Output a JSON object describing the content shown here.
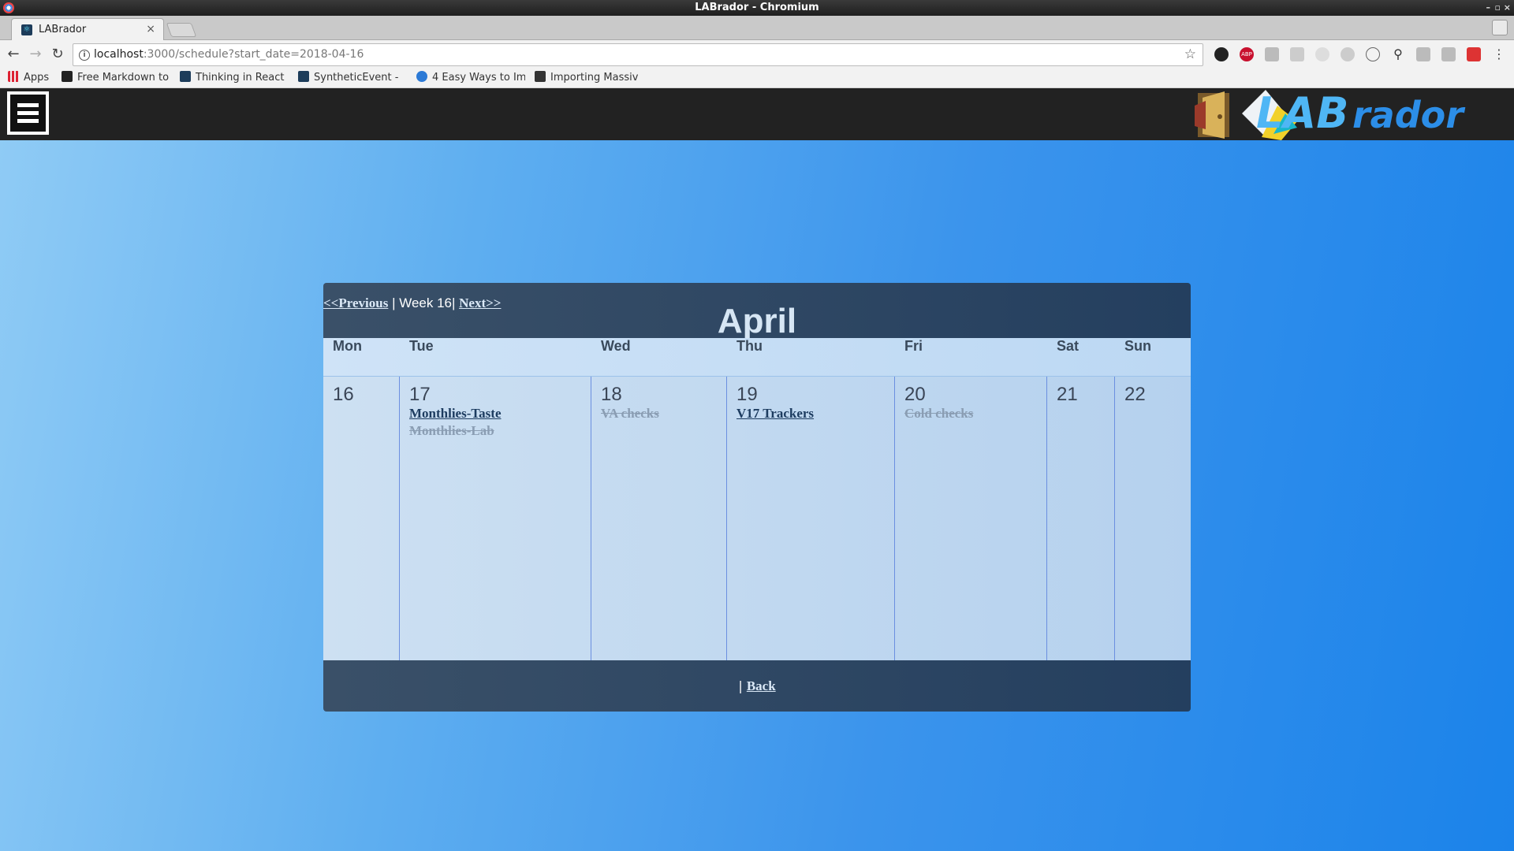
{
  "window": {
    "title": "LABrador - Chromium",
    "controls": [
      "–",
      "▫",
      "×"
    ]
  },
  "tab": {
    "title": "LABrador",
    "close": "×"
  },
  "toolbar": {
    "url_host": "localhost",
    "url_rest": ":3000/schedule?start_date=2018-04-16"
  },
  "bookmarks": [
    {
      "label": "Apps",
      "icon": "apps-grid-icon",
      "color": "#d23"
    },
    {
      "label": "Free Markdown to",
      "icon": "markdown-icon",
      "color": "#222"
    },
    {
      "label": "Thinking in React",
      "icon": "react-icon",
      "color": "#1d3c5a"
    },
    {
      "label": "SyntheticEvent -",
      "icon": "react-icon",
      "color": "#1d3c5a"
    },
    {
      "label": "4 Easy Ways to Im",
      "icon": "globe-icon",
      "color": "#2c7ad6"
    },
    {
      "label": "Importing Massiv",
      "icon": "article-icon",
      "color": "#333"
    }
  ],
  "app": {
    "logo_text": "LABrador"
  },
  "calendar": {
    "prev_label": "<<Previous",
    "week_label": " | Week 16| ",
    "next_label": "Next>>",
    "month": "April",
    "day_headers": [
      "Mon",
      "Tue",
      "Wed",
      "Thu",
      "Fri",
      "Sat",
      "Sun"
    ],
    "days": [
      {
        "num": "16",
        "events": []
      },
      {
        "num": "17",
        "events": [
          {
            "label": "Monthlies-Taste",
            "done": false
          },
          {
            "label": "Monthlies-Lab",
            "done": true
          }
        ]
      },
      {
        "num": "18",
        "events": [
          {
            "label": "VA checks",
            "done": true
          }
        ]
      },
      {
        "num": "19",
        "events": [
          {
            "label": "V17 Trackers",
            "done": false
          }
        ]
      },
      {
        "num": "20",
        "events": [
          {
            "label": "Cold checks",
            "done": true
          }
        ]
      },
      {
        "num": "21",
        "events": []
      },
      {
        "num": "22",
        "events": []
      }
    ],
    "footer_sep": "| ",
    "back_label": "Back"
  }
}
